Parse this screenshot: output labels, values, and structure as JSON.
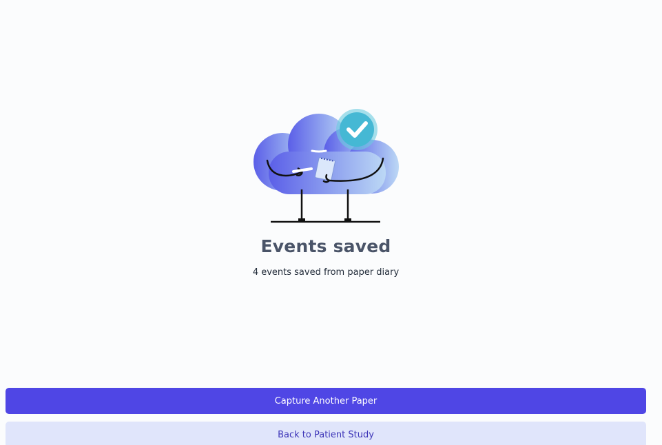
{
  "success": {
    "illustration_icon": "cloud-character-checkmark-icon",
    "title": "Events saved",
    "message": "4 events saved from paper diary"
  },
  "actions": {
    "primary_label": "Capture Another Paper",
    "secondary_label": "Back to Patient Study"
  },
  "colors": {
    "primary": "#4f46e5",
    "secondary_bg": "#e0e5fb",
    "secondary_text": "#3d35b8",
    "check_badge": "#45b8d4",
    "title_text": "#4a5468"
  }
}
